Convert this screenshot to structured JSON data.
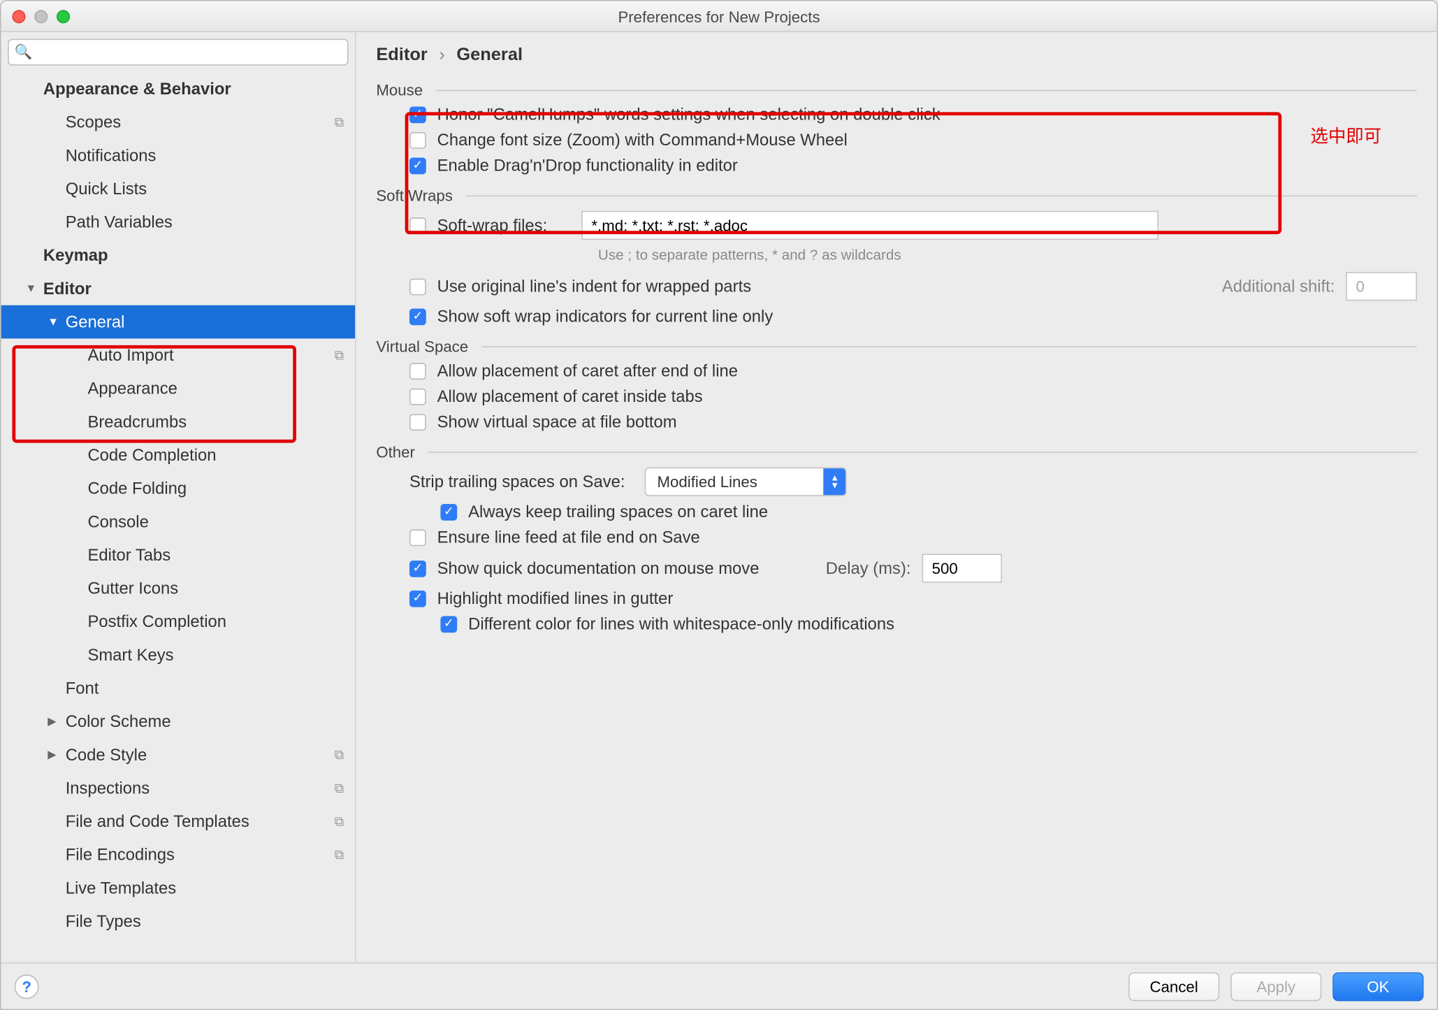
{
  "window": {
    "title": "Preferences for New Projects"
  },
  "search": {
    "placeholder": ""
  },
  "sidebar": {
    "items": [
      {
        "label": "Appearance & Behavior",
        "level": 0,
        "bold": true,
        "chev": false
      },
      {
        "label": "Scopes",
        "level": 1,
        "copy": true
      },
      {
        "label": "Notifications",
        "level": 1
      },
      {
        "label": "Quick Lists",
        "level": 1
      },
      {
        "label": "Path Variables",
        "level": 1
      },
      {
        "label": "Keymap",
        "level": 0,
        "bold": true
      },
      {
        "label": "Editor",
        "level": 0,
        "bold": true,
        "chev": "down"
      },
      {
        "label": "General",
        "level": 1,
        "chev": "down",
        "selected": true
      },
      {
        "label": "Auto Import",
        "level": 2,
        "copy": true
      },
      {
        "label": "Appearance",
        "level": 2
      },
      {
        "label": "Breadcrumbs",
        "level": 2
      },
      {
        "label": "Code Completion",
        "level": 2
      },
      {
        "label": "Code Folding",
        "level": 2
      },
      {
        "label": "Console",
        "level": 2
      },
      {
        "label": "Editor Tabs",
        "level": 2
      },
      {
        "label": "Gutter Icons",
        "level": 2
      },
      {
        "label": "Postfix Completion",
        "level": 2
      },
      {
        "label": "Smart Keys",
        "level": 2
      },
      {
        "label": "Font",
        "level": 1
      },
      {
        "label": "Color Scheme",
        "level": 1,
        "chev": "right"
      },
      {
        "label": "Code Style",
        "level": 1,
        "chev": "right",
        "copy": true
      },
      {
        "label": "Inspections",
        "level": 1,
        "copy": true
      },
      {
        "label": "File and Code Templates",
        "level": 1,
        "copy": true
      },
      {
        "label": "File Encodings",
        "level": 1,
        "copy": true
      },
      {
        "label": "Live Templates",
        "level": 1
      },
      {
        "label": "File Types",
        "level": 1
      }
    ]
  },
  "breadcrumb": {
    "root": "Editor",
    "sep": "›",
    "page": "General"
  },
  "sections": {
    "mouse": {
      "title": "Mouse",
      "honor": {
        "checked": true,
        "label": "Honor \"CamelHumps\" words settings when selecting on double click"
      },
      "zoom": {
        "checked": false,
        "label": "Change font size (Zoom) with Command+Mouse Wheel"
      },
      "dnd": {
        "checked": true,
        "label": "Enable Drag'n'Drop functionality in editor"
      }
    },
    "softwraps": {
      "title": "Soft Wraps",
      "softwrap": {
        "checked": false,
        "label": "Soft-wrap files:",
        "value": "*.md; *.txt; *.rst; *.adoc"
      },
      "helper": "Use ; to separate patterns, * and ? as wildcards",
      "indent": {
        "checked": false,
        "label": "Use original line's indent for wrapped parts"
      },
      "shiftlabel": "Additional shift:",
      "shiftvalue": "0",
      "indicators": {
        "checked": true,
        "label": "Show soft wrap indicators for current line only"
      }
    },
    "virtual": {
      "title": "Virtual Space",
      "eol": {
        "checked": false,
        "label": "Allow placement of caret after end of line"
      },
      "tabs": {
        "checked": false,
        "label": "Allow placement of caret inside tabs"
      },
      "bottom": {
        "checked": false,
        "label": "Show virtual space at file bottom"
      }
    },
    "other": {
      "title": "Other",
      "striplabel": "Strip trailing spaces on Save:",
      "stripvalue": "Modified Lines",
      "keep": {
        "checked": true,
        "label": "Always keep trailing spaces on caret line"
      },
      "lf": {
        "checked": false,
        "label": "Ensure line feed at file end on Save"
      },
      "quickdoc": {
        "checked": true,
        "label": "Show quick documentation on mouse move"
      },
      "delaylabel": "Delay (ms):",
      "delayvalue": "500",
      "gutter": {
        "checked": true,
        "label": "Highlight modified lines in gutter"
      },
      "diffcolor": {
        "checked": true,
        "label": "Different color for lines with whitespace-only modifications"
      }
    }
  },
  "annotation": "选中即可",
  "footer": {
    "cancel": "Cancel",
    "apply": "Apply",
    "ok": "OK"
  }
}
